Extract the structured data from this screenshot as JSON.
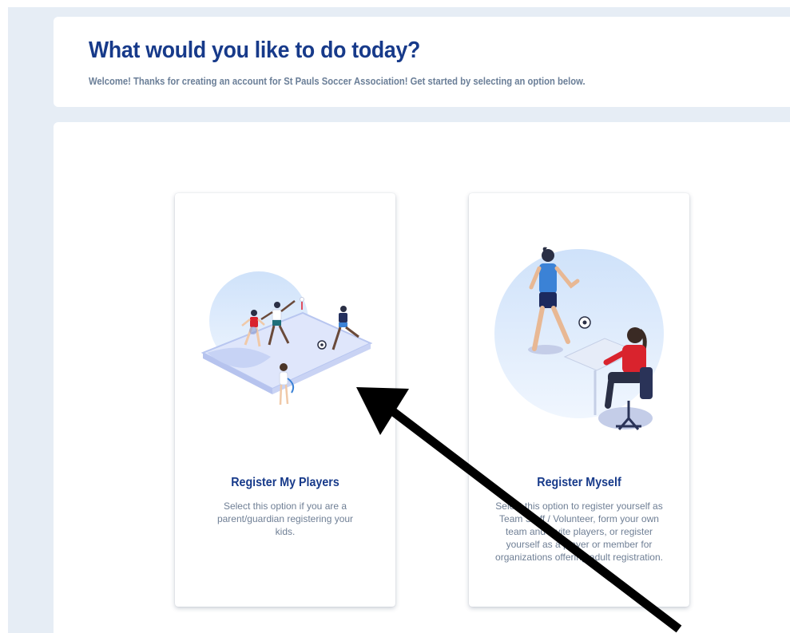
{
  "header": {
    "title": "What would you like to do today?",
    "subtitle": "Welcome! Thanks for creating an account for St Pauls Soccer Association! Get started by selecting an option below."
  },
  "options": [
    {
      "title": "Register My Players",
      "description": "Select this option if you are a parent/guardian registering your kids."
    },
    {
      "title": "Register Myself",
      "description": "Select this option to register yourself as Team Staff / Volunteer, form your own team and invite players, or register yourself as a player or member for organizations offering adult registration."
    }
  ],
  "colors": {
    "title": "#173a8a",
    "subtitle": "#6b7f98",
    "background": "#e6edf5",
    "accent_blue": "#3b82d6",
    "accent_red": "#d9232d"
  }
}
